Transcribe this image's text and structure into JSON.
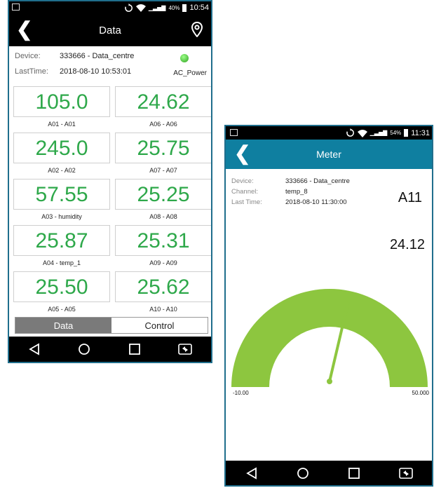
{
  "phone1": {
    "status": {
      "signal_badge": "R",
      "battery_pct": "40%",
      "time": "10:54"
    },
    "appbar": {
      "title": "Data"
    },
    "device": {
      "device_label": "Device:",
      "device_value": "333666 - Data_centre",
      "lasttime_label": "LastTime:",
      "lasttime_value": "2018-08-10 10:53:01",
      "power_label": "AC_Power"
    },
    "cells": [
      {
        "value": "105.0",
        "caption": "A01 - A01"
      },
      {
        "value": "24.62",
        "caption": "A06 - A06"
      },
      {
        "value": "245.0",
        "caption": "A02 - A02"
      },
      {
        "value": "25.75",
        "caption": "A07 - A07"
      },
      {
        "value": "57.55",
        "caption": "A03 - humidity"
      },
      {
        "value": "25.25",
        "caption": "A08 - A08"
      },
      {
        "value": "25.87",
        "caption": "A04 - temp_1"
      },
      {
        "value": "25.31",
        "caption": "A09 - A09"
      },
      {
        "value": "25.50",
        "caption": "A05 - A05"
      },
      {
        "value": "25.62",
        "caption": "A10 - A10"
      }
    ],
    "tabs": {
      "data": "Data",
      "control": "Control"
    }
  },
  "phone2": {
    "status": {
      "signal_badge": "R",
      "battery_pct": "54%",
      "time": "11:31"
    },
    "appbar": {
      "title": "Meter"
    },
    "info": {
      "device_label": "Device:",
      "device_value": "333666 - Data_centre",
      "channel_label": "Channel:",
      "channel_value": "temp_8",
      "lasttime_label": "Last Time:",
      "lasttime_value": "2018-08-10 11:30:00"
    },
    "channel_id": "A11",
    "reading": "24.12",
    "gauge": {
      "min_label": "-10.00",
      "max_label": "50.000",
      "min": -10,
      "max": 50,
      "value": 24.12,
      "color": "#8dc63f"
    }
  },
  "colors": {
    "value_green": "#2ea84a",
    "meter_appbar": "#0f7fa0",
    "led_green": "#3cb82a"
  }
}
